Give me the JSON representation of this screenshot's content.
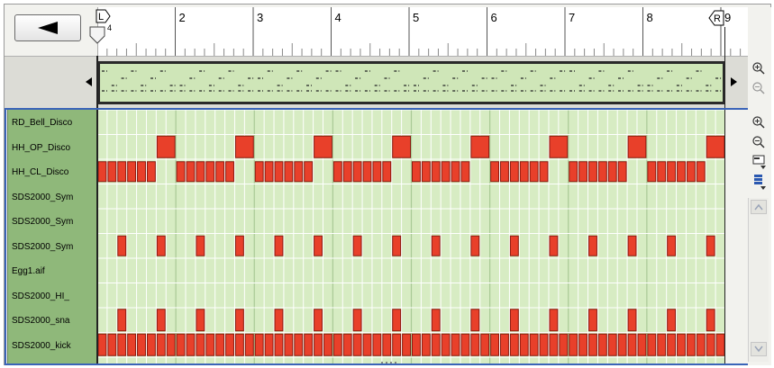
{
  "toolbar": {
    "back_icon": "triangle-left-icon"
  },
  "ruler": {
    "bars": [
      "2",
      "3",
      "4",
      "5",
      "6",
      "7",
      "8",
      "9"
    ],
    "left_marker": "L",
    "right_marker": "R",
    "position_sub": "4"
  },
  "tracks": [
    {
      "name": "RD_Bell_Disco"
    },
    {
      "name": "HH_OP_Disco"
    },
    {
      "name": "HH_CL_Disco"
    },
    {
      "name": "SDS2000_Sym"
    },
    {
      "name": "SDS2000_Sym"
    },
    {
      "name": "SDS2000_Sym"
    },
    {
      "name": "Egg1.aif"
    },
    {
      "name": "SDS2000_HI_"
    },
    {
      "name": "SDS2000_sna"
    },
    {
      "name": "SDS2000_kick"
    }
  ],
  "tools": {
    "zoom_in_icon": "zoom-in-icon",
    "zoom_out_icon": "zoom-out-icon",
    "lane_menu_icon": "lane-menu-icon",
    "color_menu_icon": "color-menu-icon"
  },
  "colors": {
    "note_fill": "#e8402a",
    "note_border": "#8a1a10",
    "grid_bg": "#d7ecc3",
    "track_bg": "#8fb87a",
    "selection": "#3a64b8"
  }
}
